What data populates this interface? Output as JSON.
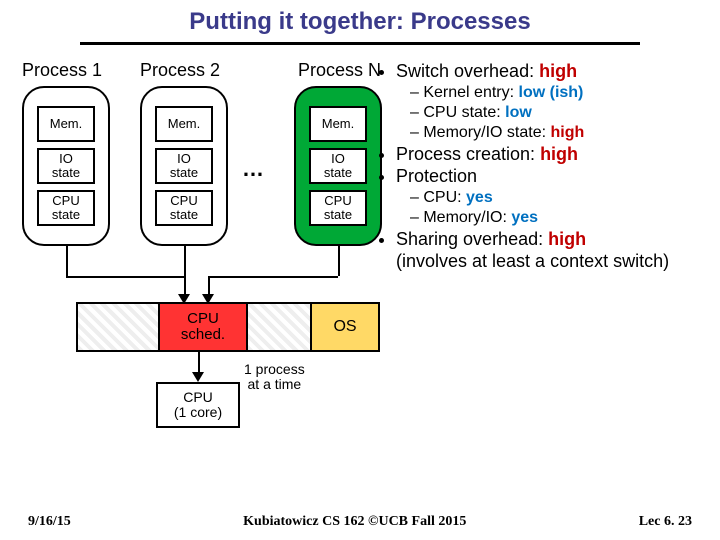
{
  "title": "Putting it together: Processes",
  "processes": {
    "labels": [
      "Process 1",
      "Process 2",
      "Process N"
    ],
    "block_mem": "Mem.",
    "block_io": "IO\nstate",
    "block_cpu": "CPU\nstate",
    "ellipsis": "…"
  },
  "scheduler": "CPU\nsched.",
  "os_label": "OS",
  "cpu_core": "CPU\n(1 core)",
  "annotation": "1 process\nat a time",
  "bullet_list": {
    "b1": "Switch overhead: ",
    "b1v": "high",
    "s1a": "Kernel entry: ",
    "s1av": "low (ish)",
    "s1b": "CPU state: ",
    "s1bv": "low",
    "s1c": "Memory/IO state: ",
    "s1cv": "high",
    "b2": "Process creation: ",
    "b2v": "high",
    "b3": "Protection",
    "s3a": "CPU: ",
    "s3av": "yes",
    "s3b": "Memory/IO: ",
    "s3bv": "yes",
    "b4": "Sharing overhead: ",
    "b4v": "high",
    "b4cont": "(involves at least a context switch)"
  },
  "footer": {
    "date": "9/16/15",
    "course": "Kubiatowicz CS 162 ©UCB Fall 2015",
    "page": "Lec 6. 23"
  }
}
